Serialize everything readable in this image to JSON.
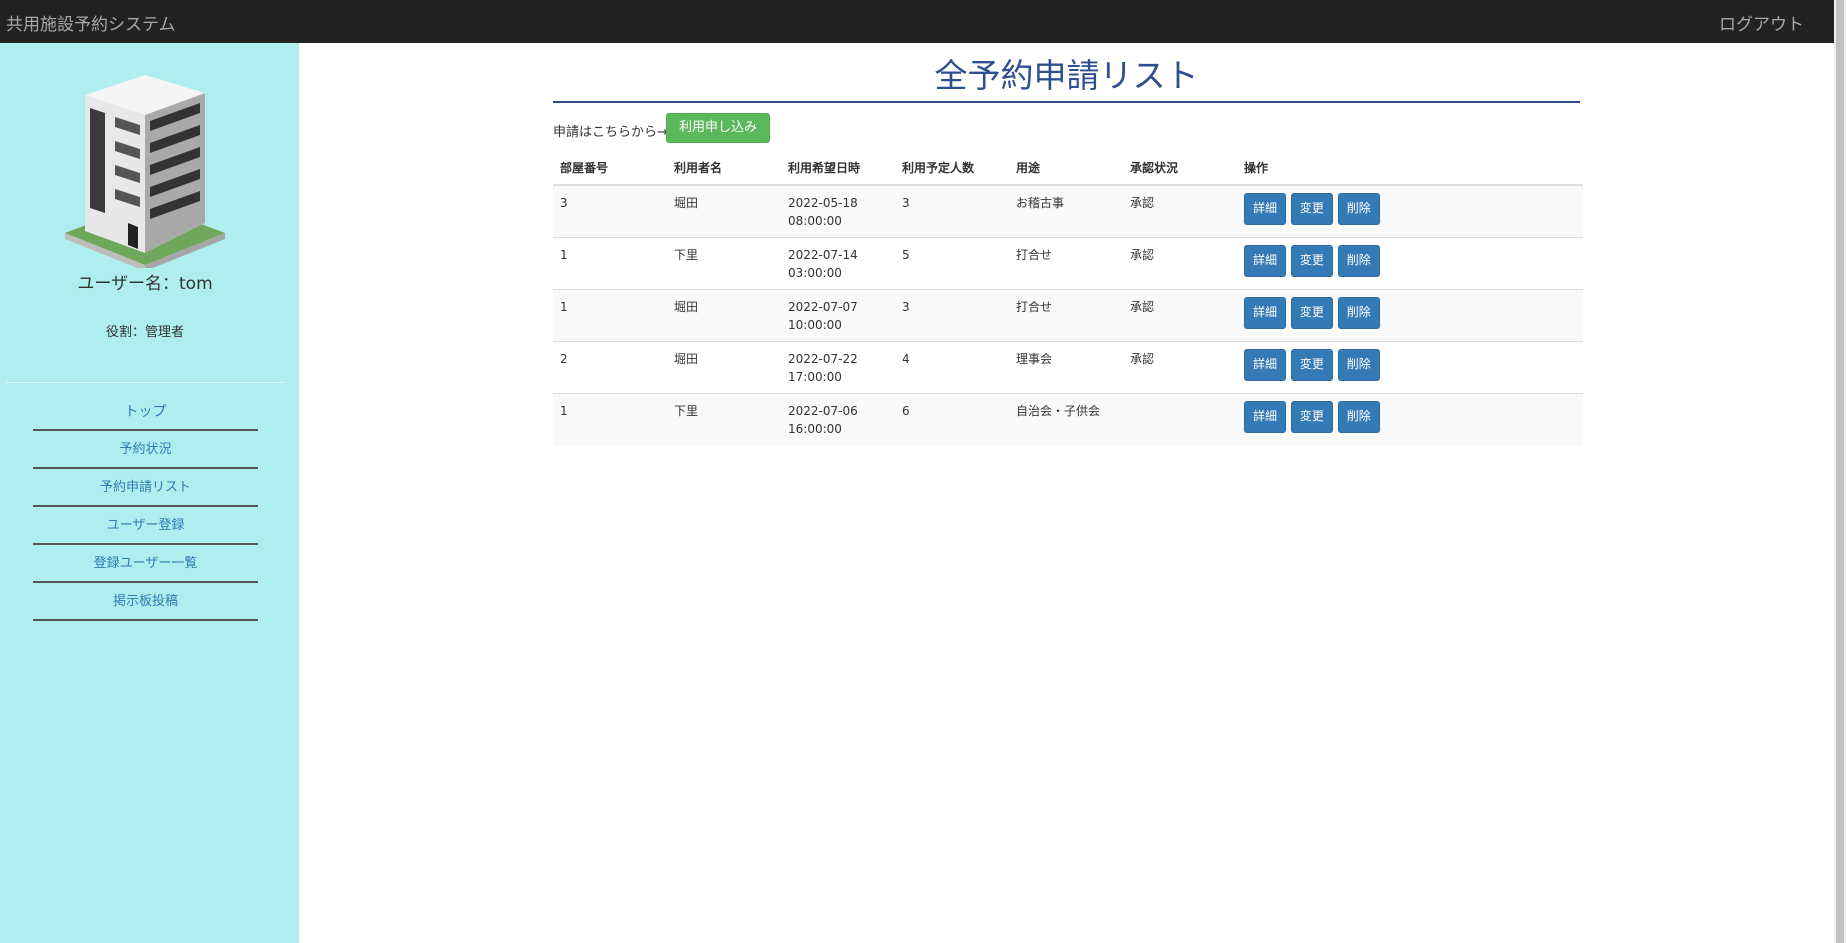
{
  "header": {
    "brand": "共用施設予約システム",
    "logout": "ログアウト"
  },
  "sidebar": {
    "username": "ユーザー名：tom",
    "role": "役割：管理者",
    "items": [
      {
        "label": "トップ"
      },
      {
        "label": "予約状況"
      },
      {
        "label": "予約申請リスト"
      },
      {
        "label": "ユーザー登録"
      },
      {
        "label": "登録ユーザー一覧"
      },
      {
        "label": "掲示板投稿"
      }
    ]
  },
  "main": {
    "title": "全予約申請リスト",
    "apply_label": "申請はこちらから→",
    "apply_button": "利用申し込み",
    "columns": [
      "部屋番号",
      "利用者名",
      "利用希望日時",
      "利用予定人数",
      "用途",
      "承認状況",
      "操作"
    ],
    "rows": [
      {
        "room": "3",
        "user": "堀田",
        "date": "2022-05-18",
        "time": "08:00:00",
        "people": "3",
        "purpose": "お稽古事",
        "status": "承認"
      },
      {
        "room": "1",
        "user": "下里",
        "date": "2022-07-14",
        "time": "03:00:00",
        "people": "5",
        "purpose": "打合せ",
        "status": "承認"
      },
      {
        "room": "1",
        "user": "堀田",
        "date": "2022-07-07",
        "time": "10:00:00",
        "people": "3",
        "purpose": "打合せ",
        "status": "承認"
      },
      {
        "room": "2",
        "user": "堀田",
        "date": "2022-07-22",
        "time": "17:00:00",
        "people": "4",
        "purpose": "理事会",
        "status": "承認"
      },
      {
        "room": "1",
        "user": "下里",
        "date": "2022-07-06",
        "time": "16:00:00",
        "people": "6",
        "purpose": "自治会・子供会",
        "status": ""
      }
    ],
    "actions": {
      "detail": "詳細",
      "edit": "変更",
      "delete": "削除"
    }
  }
}
